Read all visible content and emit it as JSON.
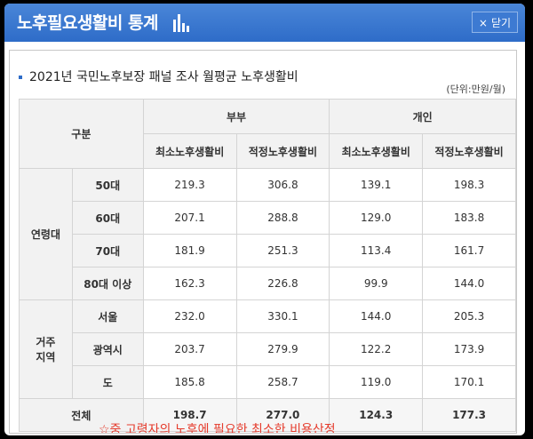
{
  "header": {
    "title": "노후필요생활비 통계",
    "close_label": "닫기",
    "close_icon": "×"
  },
  "panel": {
    "subtitle": "2021년 국민노후보장 패널 조사 월평균 노후생활비",
    "unit": "(단위:만원/월)"
  },
  "table": {
    "head": {
      "category": "구분",
      "couple": "부부",
      "individual": "개인",
      "cols": [
        "최소노후생활비",
        "적정노후생활비",
        "최소노후생활비",
        "적정노후생활비"
      ]
    },
    "groups": [
      {
        "name": "연령대",
        "rows": [
          {
            "label": "50대",
            "values": [
              "219.3",
              "306.8",
              "139.1",
              "198.3"
            ]
          },
          {
            "label": "60대",
            "values": [
              "207.1",
              "288.8",
              "129.0",
              "183.8"
            ]
          },
          {
            "label": "70대",
            "values": [
              "181.9",
              "251.3",
              "113.4",
              "161.7"
            ]
          },
          {
            "label": "80대 이상",
            "values": [
              "162.3",
              "226.8",
              "99.9",
              "144.0"
            ]
          }
        ]
      },
      {
        "name_line1": "거주",
        "name_line2": "지역",
        "rows": [
          {
            "label": "서울",
            "values": [
              "232.0",
              "330.1",
              "144.0",
              "205.3"
            ]
          },
          {
            "label": "광역시",
            "values": [
              "203.7",
              "279.9",
              "122.2",
              "173.9"
            ]
          },
          {
            "label": "도",
            "values": [
              "185.8",
              "258.7",
              "119.0",
              "170.1"
            ]
          }
        ]
      }
    ],
    "total": {
      "label": "전체",
      "values": [
        "198.7",
        "277.0",
        "124.3",
        "177.3"
      ]
    }
  },
  "note": "☆중 고령자의 노후에 필요한 최소한 비용산정"
}
